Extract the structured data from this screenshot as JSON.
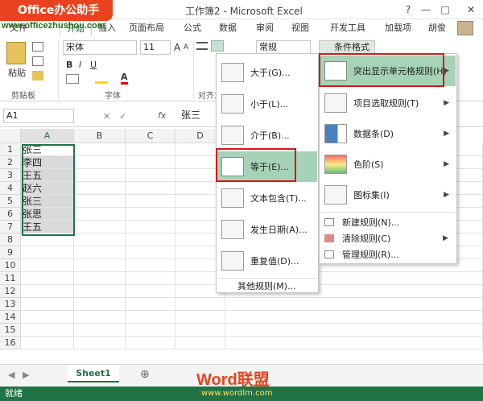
{
  "watermark": {
    "badge": "Office办公助手",
    "url": "www.officezhushou.com",
    "footer_word": "Word联盟",
    "footer_url": "www.wordlm.com"
  },
  "window": {
    "title": "工作簿2 - Microsoft Excel",
    "help": "?",
    "minimize": "—",
    "restore": "□",
    "close": "✕",
    "user": "胡俊"
  },
  "tabs": [
    "文件",
    "开始",
    "插入",
    "页面布局",
    "公式",
    "数据",
    "审阅",
    "视图",
    "开发工具",
    "加载项"
  ],
  "ribbon": {
    "paste": "粘贴",
    "font_name": "宋体",
    "font_size": "11",
    "number_format": "常规",
    "cond_format": "条件格式",
    "groups": {
      "clipboard": "剪贴板",
      "font": "字体",
      "align": "对齐方"
    },
    "bold": "B",
    "italic": "I",
    "underline": "U",
    "font_color_a": "A",
    "grow": "A",
    "shrink": "A"
  },
  "formula_bar": {
    "name_box": "A1",
    "fx": "fx",
    "value": "张三"
  },
  "grid": {
    "columns": [
      "A",
      "B",
      "C",
      "D"
    ],
    "rows": [
      "1",
      "2",
      "3",
      "4",
      "5",
      "6",
      "7",
      "8",
      "9",
      "10",
      "11",
      "12",
      "13",
      "14",
      "15",
      "16"
    ],
    "cells": [
      "张三",
      "李四",
      "王五",
      "赵六",
      "张三",
      "张思",
      "王五"
    ]
  },
  "submenu": {
    "items": [
      "大于(G)...",
      "小于(L)...",
      "介于(B)...",
      "等于(E)...",
      "文本包含(T)...",
      "发生日期(A)...",
      "重复值(D)..."
    ],
    "more": "其他规则(M)..."
  },
  "cf_menu": {
    "items": [
      "突出显示单元格规则(H)",
      "项目选取规则(T)",
      "数据条(D)",
      "色阶(S)",
      "图标集(I)"
    ],
    "small_items": [
      "新建规则(N)...",
      "清除规则(C)",
      "管理规则(R)..."
    ]
  },
  "sheet_tab": "Sheet1",
  "add_sheet": "⊕",
  "status": "就绪",
  "colors": {
    "excel_green": "#217346",
    "highlight": "#a6d3b7",
    "red_box": "#d11a1a",
    "badge": "#e8431e"
  }
}
